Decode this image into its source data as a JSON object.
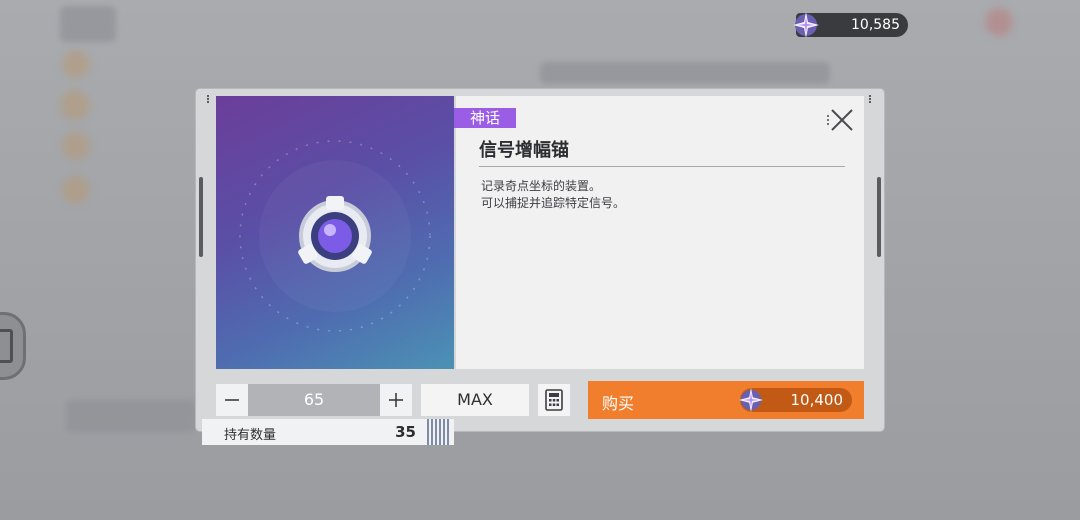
{
  "currency": {
    "icon": "crystal-icon",
    "amount": "10,585"
  },
  "item": {
    "rarity": "神话",
    "rarity_color": "#9b5de5",
    "name": "信号增幅锚",
    "description": "记录奇点坐标的装置。\n可以捕捉并追踪特定信号。",
    "owned_label": "持有数量",
    "owned_count": "35"
  },
  "purchase": {
    "quantity": "65",
    "max_label": "MAX",
    "buy_label": "购买",
    "price": "10,400",
    "buy_color": "#f07e2c"
  }
}
